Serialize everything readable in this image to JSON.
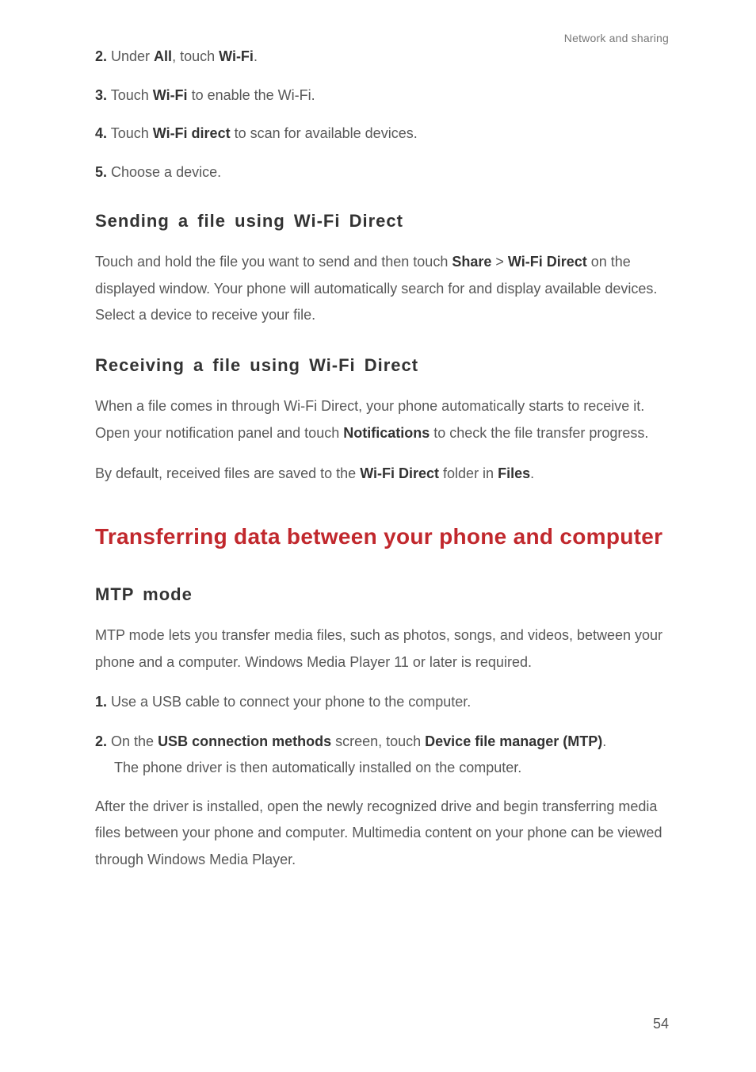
{
  "header": {
    "right": "Network and sharing"
  },
  "steps_top": [
    {
      "num": "2.",
      "pre": " Under ",
      "b1": "All",
      "mid": ", touch ",
      "b2": "Wi-Fi",
      "post": "."
    },
    {
      "num": "3.",
      "pre": " Touch ",
      "b1": "Wi-Fi",
      "mid": " to enable the Wi-Fi.",
      "b2": "",
      "post": ""
    },
    {
      "num": "4.",
      "pre": " Touch ",
      "b1": "Wi-Fi direct",
      "mid": " to scan for available devices.",
      "b2": "",
      "post": ""
    },
    {
      "num": "5.",
      "pre": " Choose a device.",
      "b1": "",
      "mid": "",
      "b2": "",
      "post": ""
    }
  ],
  "sending": {
    "title": "Sending a file using Wi-Fi Direct",
    "p1_a": "Touch and hold the file you want to send and then touch ",
    "p1_b1": "Share",
    "p1_gt": " > ",
    "p1_b2": "Wi-Fi Direct",
    "p1_c": " on the displayed window. Your phone will automatically search for and display available devices. Select a device to receive your file."
  },
  "receiving": {
    "title": "Receiving a file using Wi-Fi Direct",
    "p1_a": "When a file comes in through Wi-Fi Direct, your phone automatically starts to receive it. Open your notification panel and touch ",
    "p1_b": "Notifications",
    "p1_c": " to check the file transfer progress.",
    "p2_a": "By default, received files are saved to the ",
    "p2_b": "Wi-Fi Direct",
    "p2_c": " folder in ",
    "p2_d": "Files",
    "p2_e": "."
  },
  "transfer": {
    "title": "Transferring data between your phone and computer"
  },
  "mtp": {
    "title": "MTP mode",
    "intro": "MTP mode lets you transfer media files, such as photos, songs, and videos, between your phone and a computer. Windows Media Player 11 or later is required.",
    "step1_num": "1.",
    "step1_txt": " Use a USB cable to connect your phone to the computer.",
    "step2_num": "2.",
    "step2_a": " On the ",
    "step2_b1": "USB connection methods",
    "step2_mid": " screen, touch ",
    "step2_b2": "Device file manager (MTP)",
    "step2_c": ".",
    "step2_line2": "The phone driver is then automatically installed on the computer.",
    "after": "After the driver is installed, open the newly recognized drive and begin transferring media files between your phone and computer. Multimedia content on your phone can be viewed through Windows Media Player."
  },
  "page_number": "54"
}
